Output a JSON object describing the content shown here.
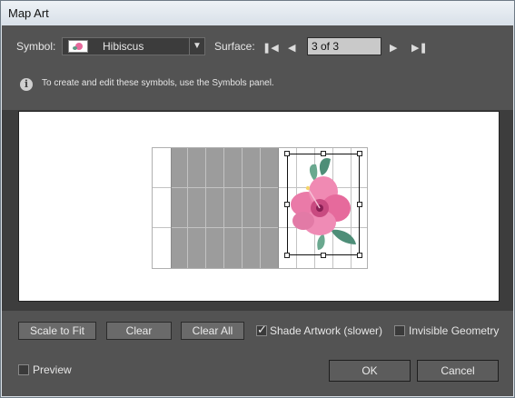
{
  "window": {
    "title": "Map Art"
  },
  "symbol": {
    "label": "Symbol:",
    "value": "Hibiscus",
    "swatch_icon": "hibiscus-icon"
  },
  "surface": {
    "label": "Surface:",
    "value": "3 of 3"
  },
  "info": {
    "text": "To create and edit these symbols, use the Symbols panel."
  },
  "buttons": {
    "scale_to_fit": "Scale to Fit",
    "clear": "Clear",
    "clear_all": "Clear All",
    "ok": "OK",
    "cancel": "Cancel"
  },
  "options": {
    "shade_artwork": {
      "label": "Shade Artwork (slower)",
      "checked": true
    },
    "invisible_geometry": {
      "label": "Invisible Geometry",
      "checked": false
    },
    "preview": {
      "label": "Preview",
      "checked": false
    }
  },
  "colors": {
    "dialog_bg": "#535353",
    "preview_bg": "#ffffff",
    "selection_border": "#111111",
    "flower_pink": "#e66a9c",
    "leaf_green": "#5e9a85"
  }
}
